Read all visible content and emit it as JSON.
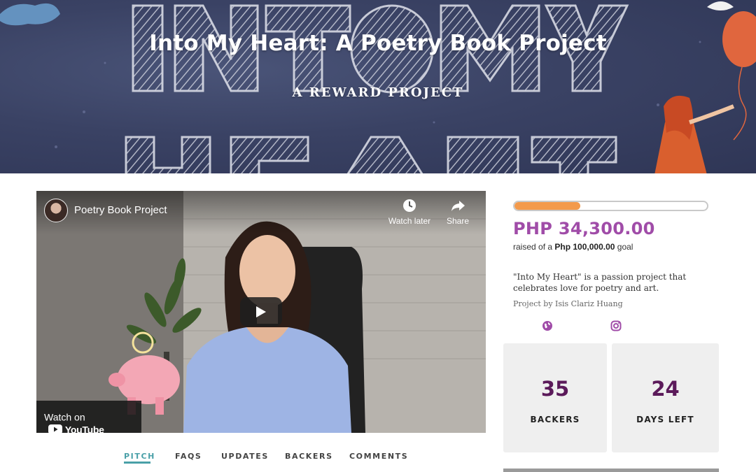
{
  "hero": {
    "title": "Into My Heart: A Poetry Book Project",
    "subtitle": "A REWARD PROJECT"
  },
  "video": {
    "title": "Poetry Book Project",
    "watch_later_label": "Watch later",
    "share_label": "Share",
    "watch_on_label": "Watch on",
    "youtube_label": "YouTube"
  },
  "tabs": [
    {
      "label": "PITCH",
      "active": true
    },
    {
      "label": "FAQS",
      "active": false
    },
    {
      "label": "UPDATES",
      "active": false
    },
    {
      "label": "BACKERS",
      "active": false
    },
    {
      "label": "COMMENTS",
      "active": false
    }
  ],
  "funding": {
    "amount": "PHP 34,300.00",
    "raised_prefix": "raised of a ",
    "goal_amount": "Php 100,000.00",
    "goal_suffix": " goal",
    "progress_fraction": 0.343
  },
  "description": "\"Into My Heart\" is a passion project that celebrates love for poetry and art.",
  "byline": "Project by Isis Clariz Huang",
  "social": {
    "website_icon": "globe-icon",
    "instagram_icon": "instagram-icon"
  },
  "stats": {
    "backers": {
      "value": "35",
      "label": "BACKERS"
    },
    "days_left": {
      "value": "24",
      "label": "DAYS LEFT"
    }
  },
  "colors": {
    "accent_purple": "#a04ca8",
    "stat_number": "#5b1a5a",
    "progress_fill": "#f39a4c",
    "tab_active": "#4aa0a8",
    "hero_bg": "#3a4264"
  }
}
